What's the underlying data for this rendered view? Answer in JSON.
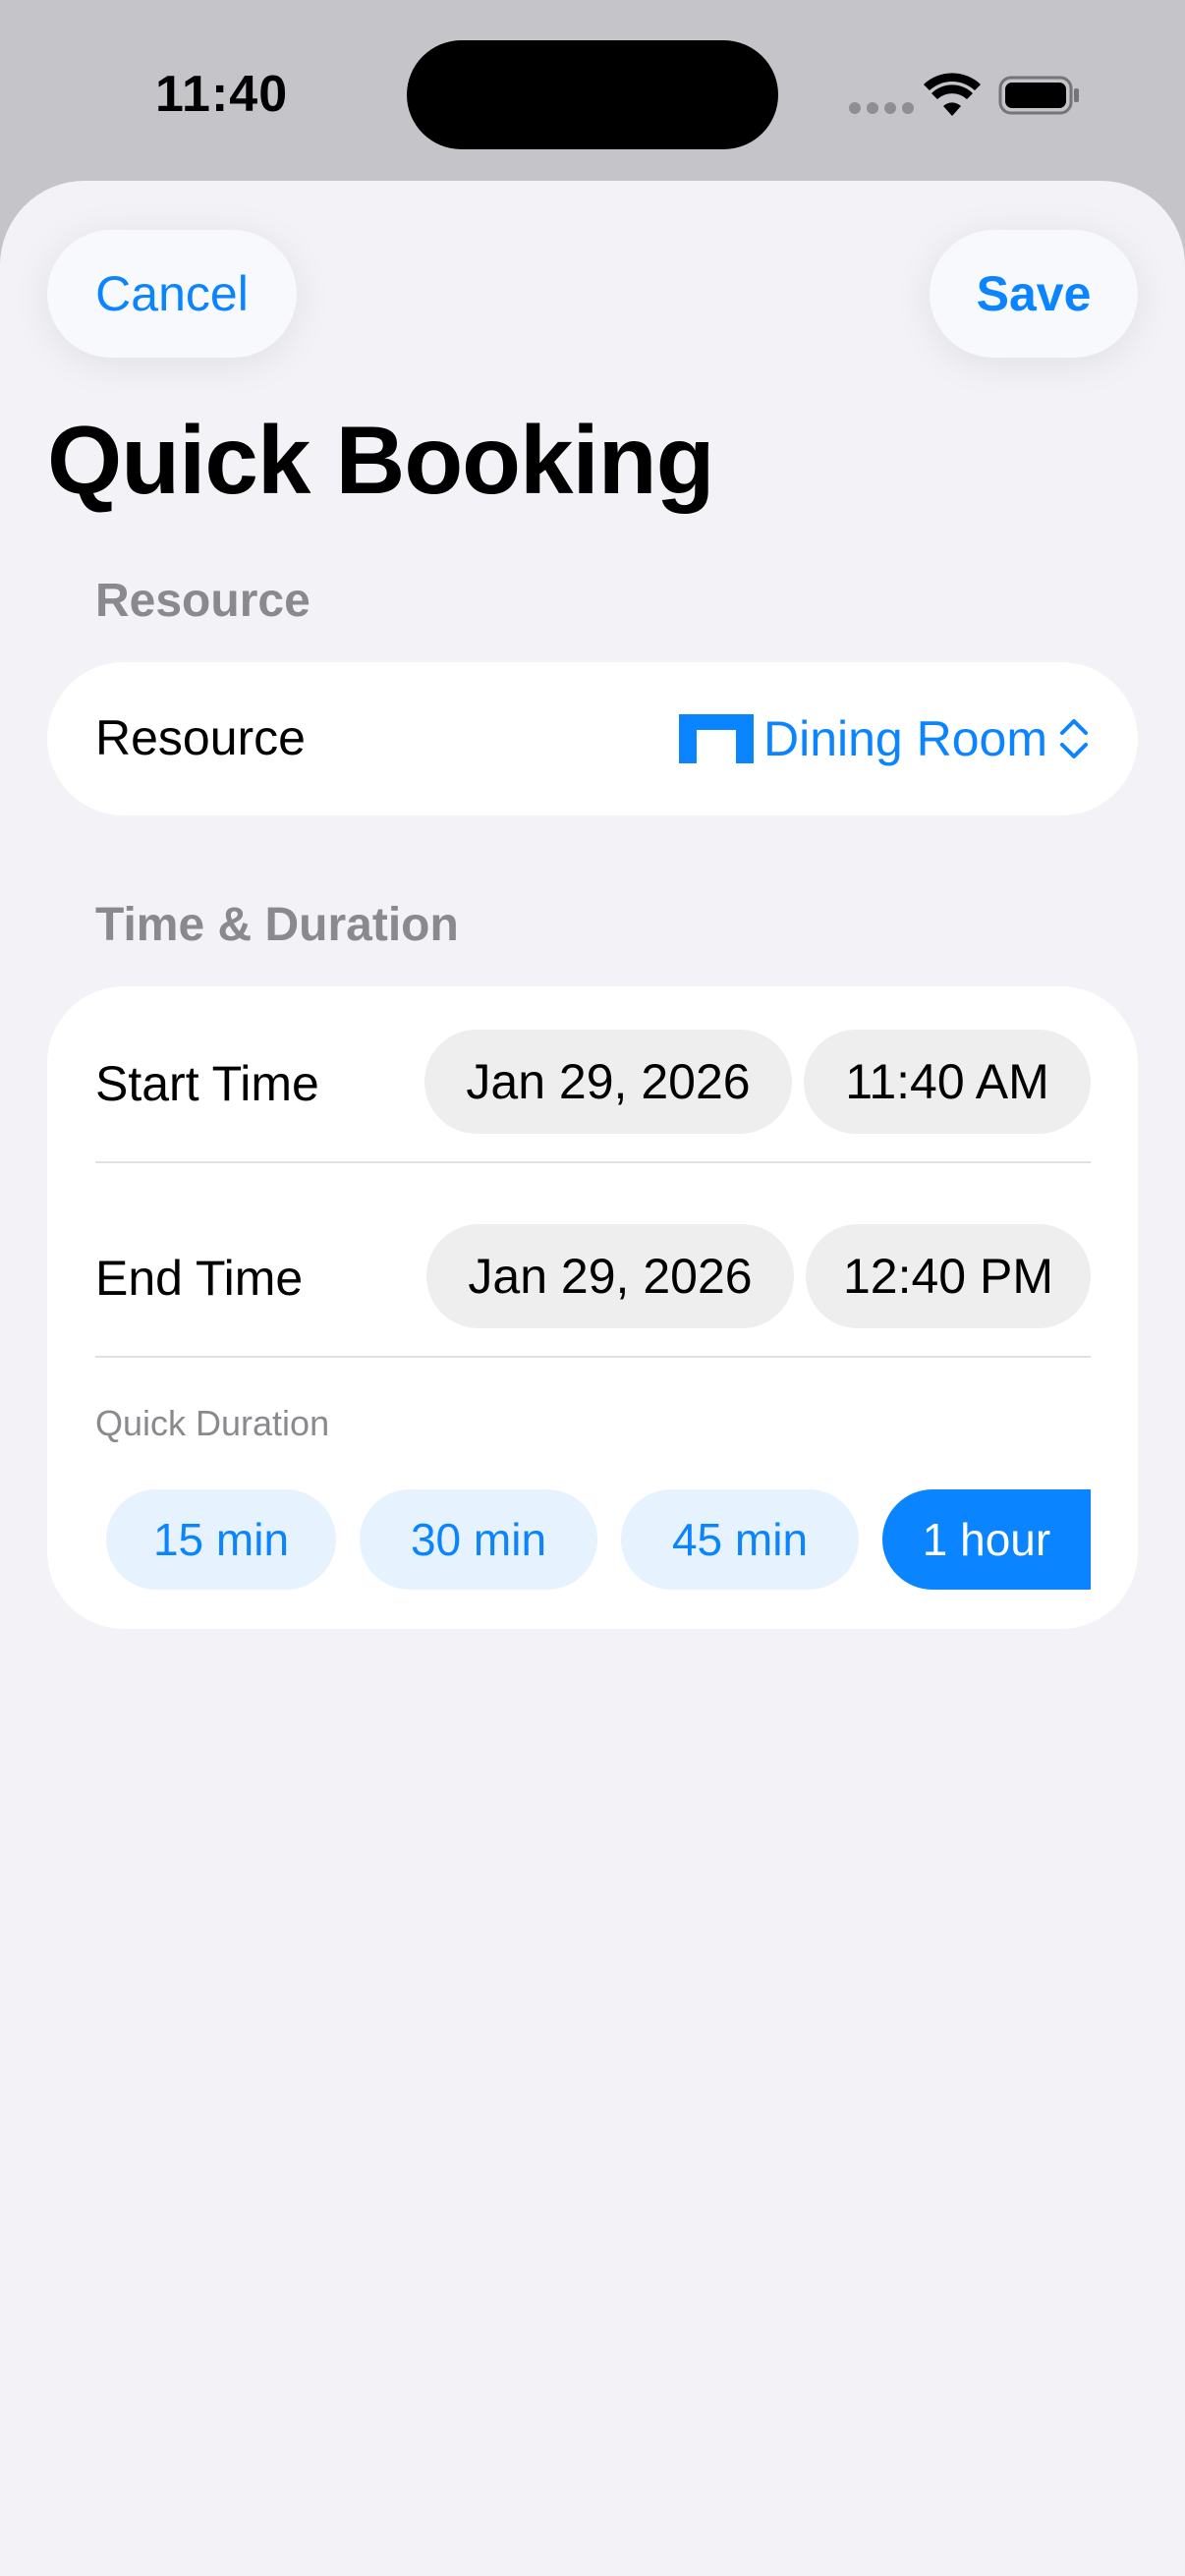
{
  "status_bar": {
    "time": "11:40"
  },
  "header": {
    "cancel_label": "Cancel",
    "save_label": "Save",
    "title": "Quick Booking"
  },
  "resource_section": {
    "section_label": "Resource",
    "row_label": "Resource",
    "selected_value": "Dining Room",
    "icon": "room-icon"
  },
  "time_section": {
    "section_label": "Time & Duration",
    "start": {
      "label": "Start Time",
      "date": "Jan 29, 2026",
      "time": "11:40 AM"
    },
    "end": {
      "label": "End Time",
      "date": "Jan 29, 2026",
      "time": "12:40 PM"
    },
    "quick_duration": {
      "label": "Quick Duration",
      "options": [
        "15 min",
        "30 min",
        "45 min",
        "1 hour"
      ],
      "selected": "1 hour"
    }
  },
  "colors": {
    "accent": "#0a84ff",
    "background": "#f2f2f7",
    "chip": "#eeeeef"
  }
}
